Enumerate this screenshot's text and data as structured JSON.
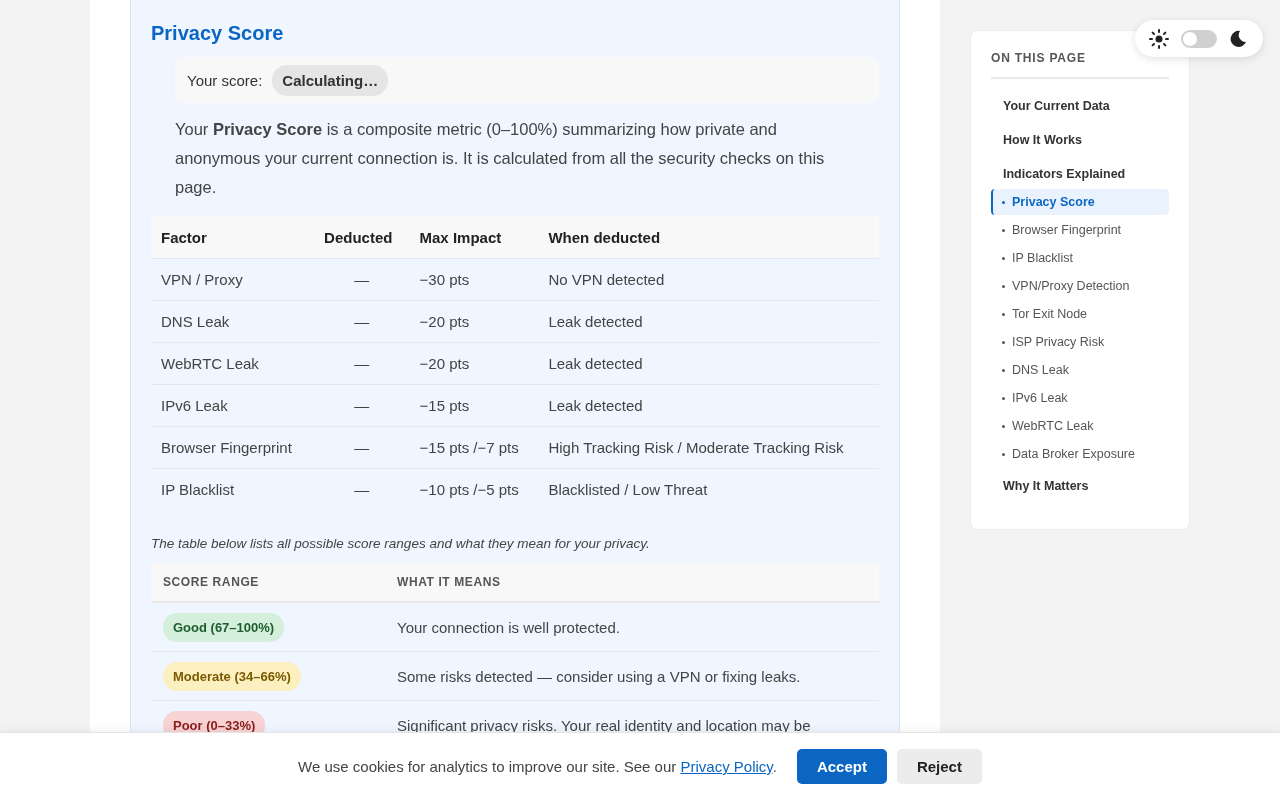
{
  "section": {
    "title": "Privacy Score",
    "score_label": "Your score:",
    "score_value": "Calculating…",
    "intro": "Your **Privacy Score** is a composite metric (0–100%) summarizing how private and anonymous your current connection is. It is calculated from all the security checks on this page.",
    "factors": {
      "columns": [
        "Factor",
        "Deducted",
        "Max Impact",
        "When deducted"
      ],
      "rows": [
        [
          "VPN / Proxy",
          "—",
          "−30 pts",
          "No VPN detected"
        ],
        [
          "DNS Leak",
          "—",
          "−20 pts",
          "Leak detected"
        ],
        [
          "WebRTC Leak",
          "—",
          "−20 pts",
          "Leak detected"
        ],
        [
          "IPv6 Leak",
          "—",
          "−15 pts",
          "Leak detected"
        ],
        [
          "Browser Fingerprint",
          "—",
          "−15 pts /−7 pts",
          "High Tracking Risk / Moderate Tracking Risk"
        ],
        [
          "IP Blacklist",
          "—",
          "−10 pts /−5 pts",
          "Blacklisted / Low Threat"
        ]
      ]
    },
    "note": "The table below lists all possible score ranges and what they mean for your privacy.",
    "ranges": {
      "columns": [
        "SCORE RANGE",
        "WHAT IT MEANS"
      ],
      "rows": [
        {
          "kind": "good",
          "label": "Good (67–100%)",
          "meaning": "Your connection is well protected."
        },
        {
          "kind": "moderate",
          "label": "Moderate (34–66%)",
          "meaning": "Some risks detected — consider using a VPN or fixing leaks."
        },
        {
          "kind": "poor",
          "label": "Poor (0–33%)",
          "meaning": "Significant privacy risks. Your real identity and location may be"
        }
      ]
    }
  },
  "theme_toggle": {
    "on": false
  },
  "toc": {
    "title": "ON THIS PAGE",
    "items": [
      {
        "label": "Your Current Data",
        "selected": false
      },
      {
        "label": "How It Works",
        "selected": false
      },
      {
        "label": "Indicators Explained",
        "selected": false,
        "children": [
          {
            "label": "Privacy Score",
            "selected": true
          },
          {
            "label": "Browser Fingerprint",
            "selected": false
          },
          {
            "label": "IP Blacklist",
            "selected": false
          },
          {
            "label": "VPN/Proxy Detection",
            "selected": false
          },
          {
            "label": "Tor Exit Node",
            "selected": false
          },
          {
            "label": "ISP Privacy Risk",
            "selected": false
          },
          {
            "label": "DNS Leak",
            "selected": false
          },
          {
            "label": "IPv6 Leak",
            "selected": false
          },
          {
            "label": "WebRTC Leak",
            "selected": false
          },
          {
            "label": "Data Broker Exposure",
            "selected": false
          }
        ]
      },
      {
        "label": "Why It Matters",
        "selected": false
      }
    ]
  },
  "cookie_banner": {
    "text_before": "We use cookies for analytics to improve our site. See our",
    "link": "Privacy Policy",
    "text_after": ".",
    "buttons": [
      "Accept",
      "Reject"
    ]
  }
}
